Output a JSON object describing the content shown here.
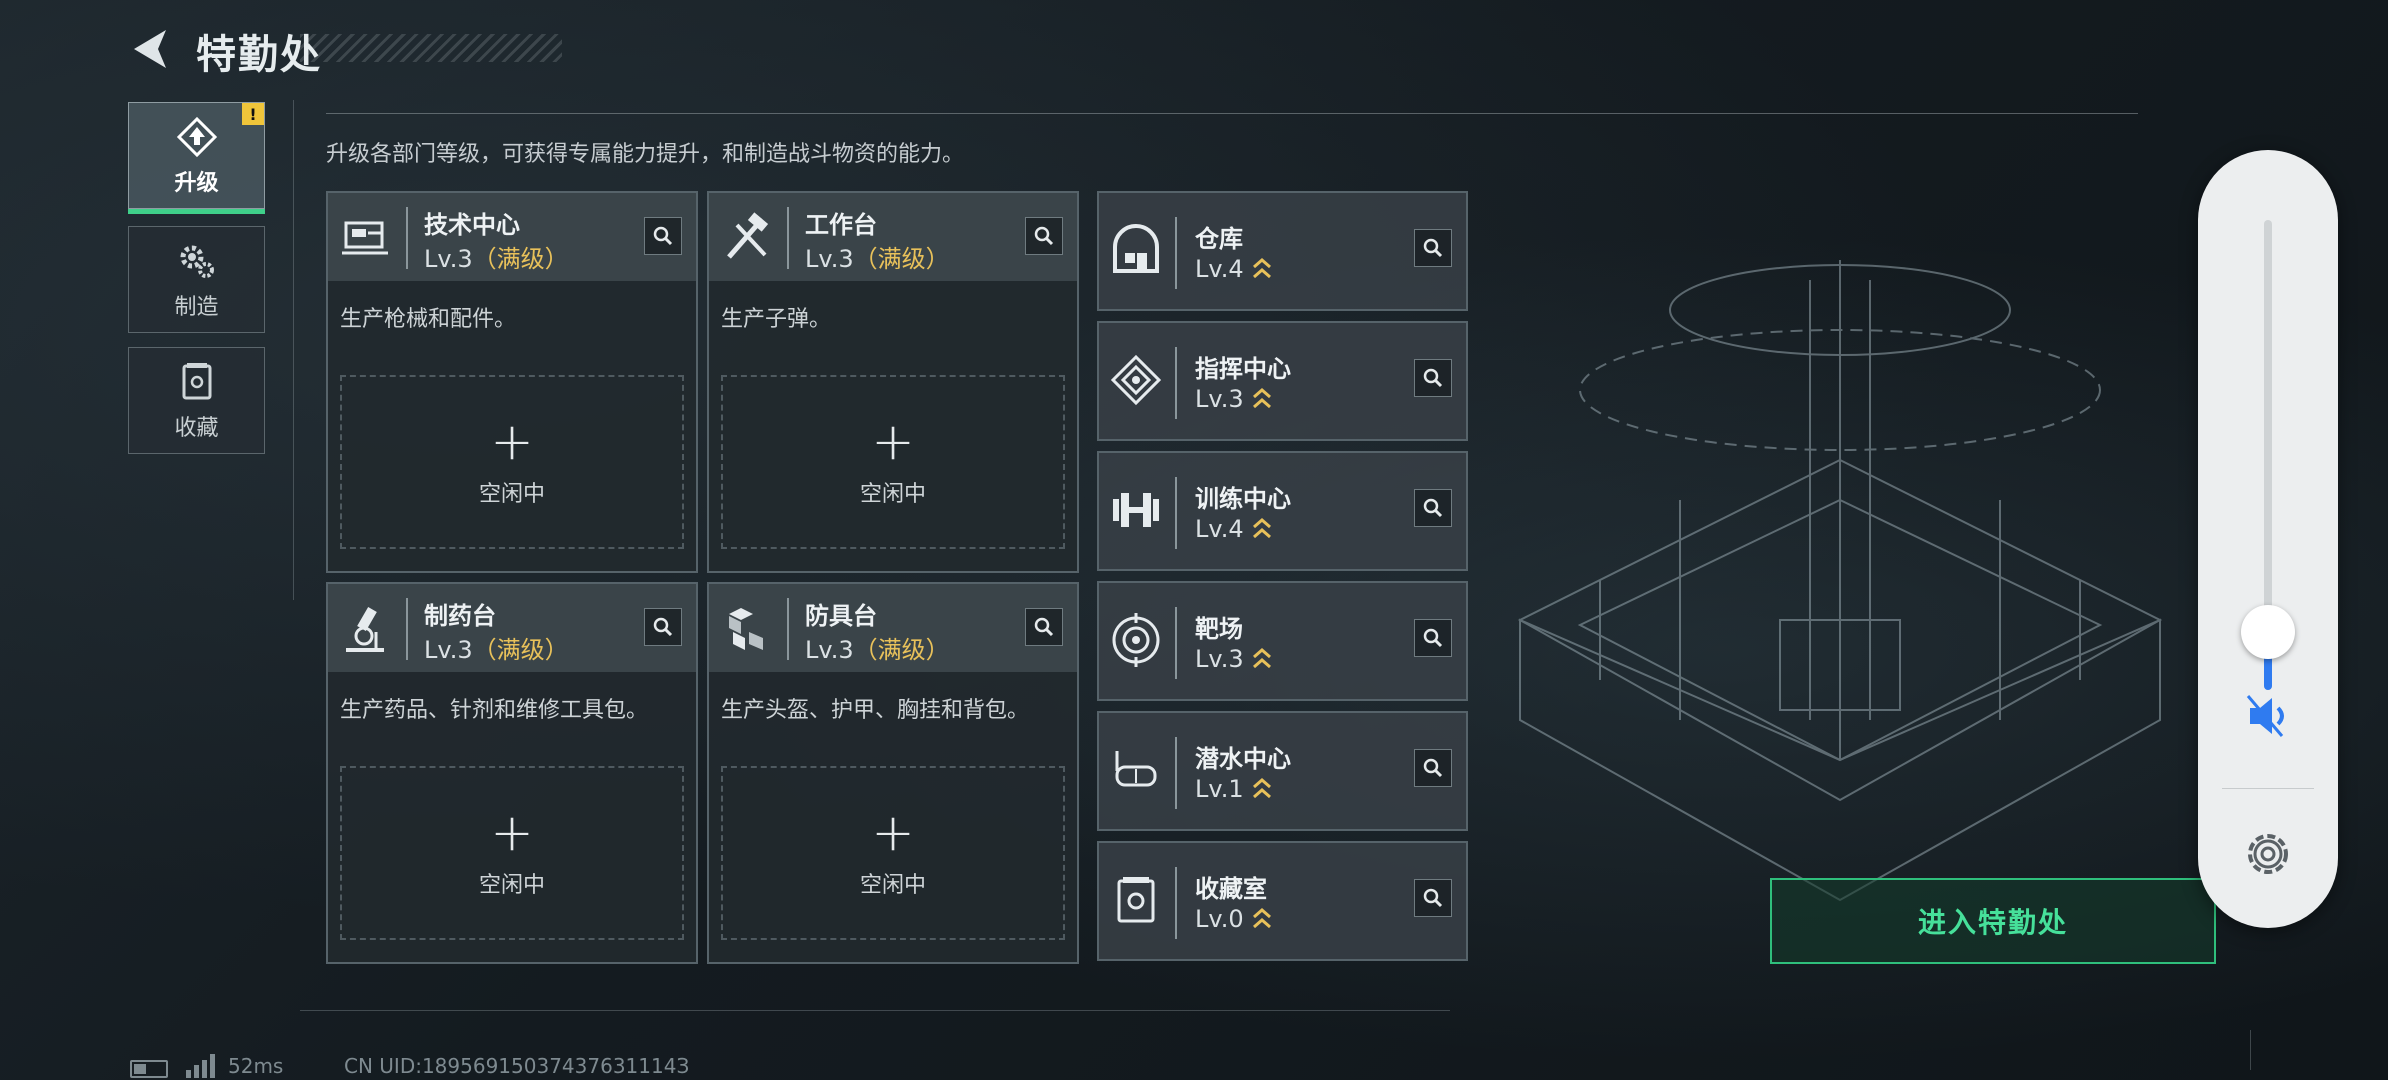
{
  "header": {
    "title": "特勤处"
  },
  "side_nav": [
    {
      "label": "升级",
      "icon": "upgrade-icon",
      "active": true,
      "alert": "!"
    },
    {
      "label": "制造",
      "icon": "craft-gears-icon",
      "active": false
    },
    {
      "label": "收藏",
      "icon": "collection-case-icon",
      "active": false
    }
  ],
  "subtitle": "升级各部门等级，可获得专属能力提升，和制造战斗物资的能力。",
  "production_cards": [
    {
      "name": "技术中心",
      "level": "Lv.3",
      "max": "（满级）",
      "desc": "生产枪械和配件。",
      "slot_plus": "+",
      "slot_status": "空闲中",
      "icon": "tech-center-icon"
    },
    {
      "name": "工作台",
      "level": "Lv.3",
      "max": "（满级）",
      "desc": "生产子弹。",
      "slot_plus": "+",
      "slot_status": "空闲中",
      "icon": "workbench-tools-icon"
    },
    {
      "name": "制药台",
      "level": "Lv.3",
      "max": "（满级）",
      "desc": "生产药品、针剂和维修工具包。",
      "slot_plus": "+",
      "slot_status": "空闲中",
      "icon": "microscope-icon"
    },
    {
      "name": "防具台",
      "level": "Lv.3",
      "max": "（满级）",
      "desc": "生产头盔、护甲、胸挂和背包。",
      "slot_plus": "+",
      "slot_status": "空闲中",
      "icon": "armor-blocks-icon"
    }
  ],
  "facilities": [
    {
      "name": "仓库",
      "level": "Lv.4",
      "icon": "warehouse-icon"
    },
    {
      "name": "指挥中心",
      "level": "Lv.3",
      "icon": "command-center-icon"
    },
    {
      "name": "训练中心",
      "level": "Lv.4",
      "icon": "dumbbell-icon"
    },
    {
      "name": "靶场",
      "level": "Lv.3",
      "icon": "target-icon"
    },
    {
      "name": "潜水中心",
      "level": "Lv.1",
      "icon": "diving-mask-icon"
    },
    {
      "name": "收藏室",
      "level": "Lv.0",
      "icon": "collection-room-icon"
    }
  ],
  "enter_button": "进入特勤处",
  "volume": {
    "level": 0.08
  },
  "status_bar": {
    "ping": "52ms",
    "uid": "CN UID:18956915037437631114З"
  },
  "colors": {
    "accent_green": "#46e09a",
    "max_level_gold": "#e8c15a",
    "volume_blue": "#2f7bf0"
  }
}
